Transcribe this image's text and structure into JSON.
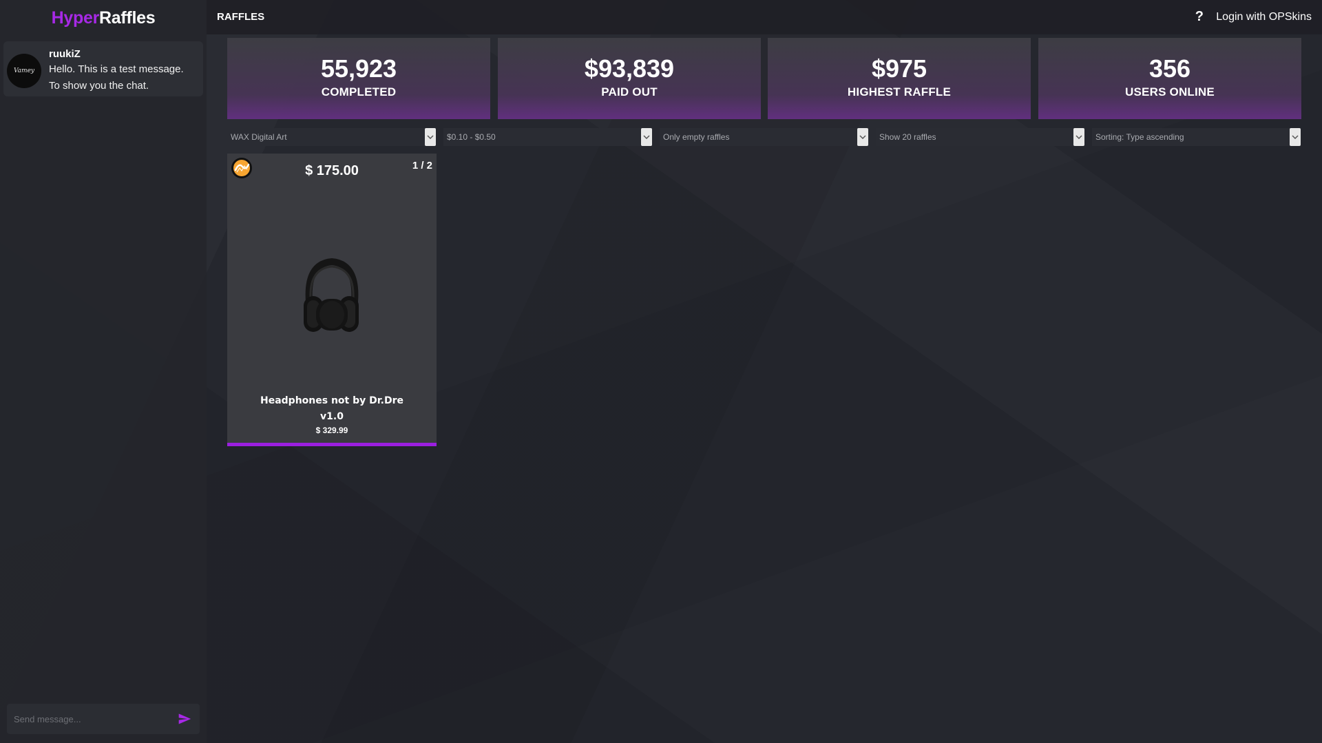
{
  "brand": {
    "part1": "Hyper",
    "part2": "Raffles"
  },
  "chat": {
    "messages": [
      {
        "avatar_text": "Vamey",
        "user": "ruukiZ",
        "text": "Hello. This is a test message. To show you the chat."
      }
    ],
    "input_placeholder": "Send message..."
  },
  "topbar": {
    "title": "RAFFLES",
    "help": "?",
    "login": "Login with OPSkins"
  },
  "stats": [
    {
      "value": "55,923",
      "label": "COMPLETED"
    },
    {
      "value": "$93,839",
      "label": "PAID OUT"
    },
    {
      "value": "$975",
      "label": "HIGHEST RAFFLE"
    },
    {
      "value": "356",
      "label": "USERS ONLINE"
    }
  ],
  "filters": [
    {
      "label": "WAX Digital Art"
    },
    {
      "label": "$0.10 - $0.50"
    },
    {
      "label": "Only empty raffles"
    },
    {
      "label": "Show 20 raffles"
    },
    {
      "label": "Sorting: Type ascending"
    }
  ],
  "raffles": [
    {
      "price": "$ 175.00",
      "slots": "1 / 2",
      "name": "Headphones not by Dr.Dre v1.0",
      "value": "$ 329.99",
      "icon": "wax-logo-icon",
      "item_image": "headphones-icon",
      "progress_fraction": 1.0
    }
  ],
  "colors": {
    "accent": "#a729e6",
    "progress": "#9b1fe0"
  }
}
